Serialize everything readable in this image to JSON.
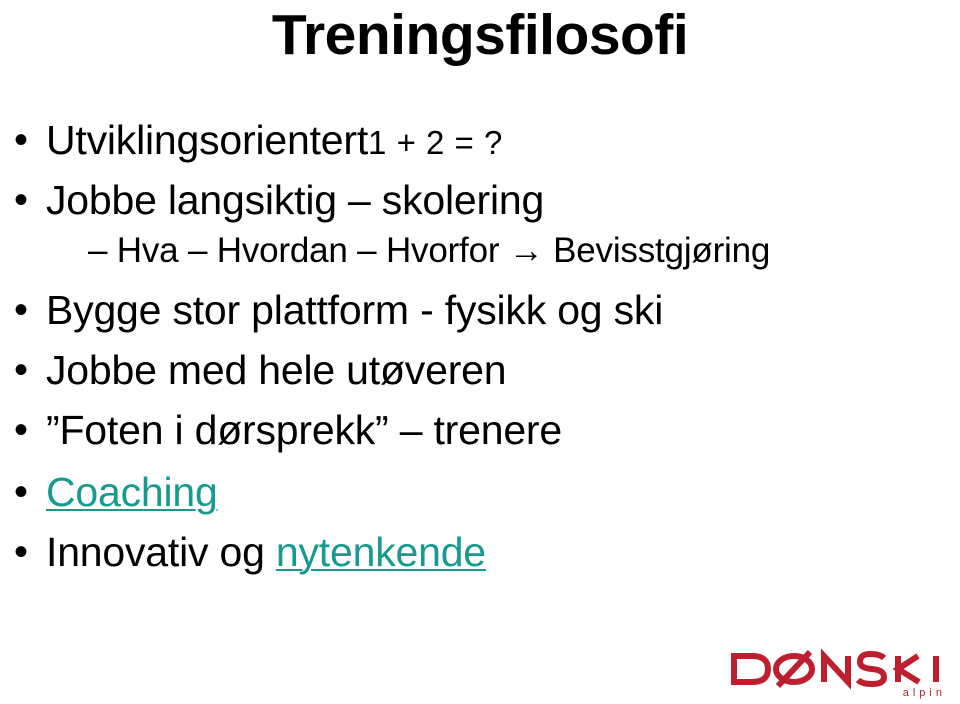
{
  "slide": {
    "title": "Treningsfilosofi",
    "background_color": "#ffffff",
    "text_color": "#000000",
    "link_color": "#169b8e",
    "bullet_glyph": "•",
    "dash_glyph": "–",
    "bullets": [
      {
        "text": "Utviklingsorientert",
        "suffix": "1 + 2 = ?"
      },
      {
        "text": "Jobbe langsiktig – skolering"
      },
      {
        "text": "Bygge stor plattform - fysikk og ski"
      },
      {
        "text": "Jobbe med hele utøveren"
      },
      {
        "text": "”Foten i dørsprekk” – trenere"
      },
      {
        "text": "Coaching"
      },
      {
        "prefix": "Innovativ og ",
        "link": "nytenkende"
      }
    ],
    "sub_bullet": "– Hva – Hvordan – Hvorfor → Bevisstgjøring"
  },
  "logo": {
    "wordmark": "DØNSKI",
    "tagline": "alpin",
    "color": "#be1e2d"
  }
}
